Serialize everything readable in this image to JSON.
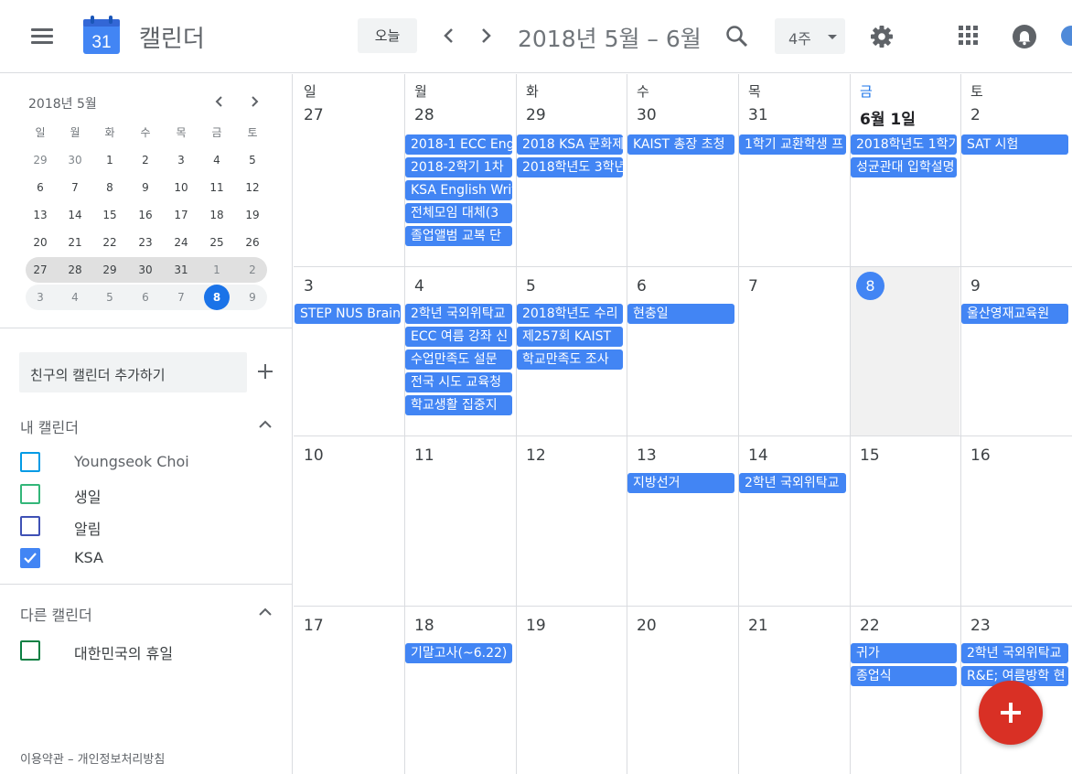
{
  "header": {
    "app_title": "캘린더",
    "logo_number": "31",
    "today_label": "오늘",
    "date_range": "2018년 5월 – 6월",
    "view_label": "4주"
  },
  "mini_calendar": {
    "title": "2018년 5월",
    "weekdays": [
      "일",
      "월",
      "화",
      "수",
      "목",
      "금",
      "토"
    ],
    "weeks": [
      [
        "29",
        "30",
        "1",
        "2",
        "3",
        "4",
        "5"
      ],
      [
        "6",
        "7",
        "8",
        "9",
        "10",
        "11",
        "12"
      ],
      [
        "13",
        "14",
        "15",
        "16",
        "17",
        "18",
        "19"
      ],
      [
        "20",
        "21",
        "22",
        "23",
        "24",
        "25",
        "26"
      ],
      [
        "27",
        "28",
        "29",
        "30",
        "31",
        "1",
        "2"
      ],
      [
        "3",
        "4",
        "5",
        "6",
        "7",
        "8",
        "9"
      ]
    ],
    "today": "8"
  },
  "sidebar": {
    "add_friend_placeholder": "친구의 캘린더 추가하기",
    "my_calendars_title": "내 캘린더",
    "my_calendars": [
      {
        "name": "Youngseok Choi",
        "color": "#039be5",
        "checked": false
      },
      {
        "name": "생일",
        "color": "#33b679",
        "checked": false
      },
      {
        "name": "알림",
        "color": "#3f51b5",
        "checked": false
      },
      {
        "name": "KSA",
        "color": "#4285f4",
        "checked": true
      }
    ],
    "other_calendars_title": "다른 캘린더",
    "other_calendars": [
      {
        "name": "대한민국의 휴일",
        "color": "#0b8043",
        "checked": false
      }
    ],
    "footer": "이용약관 – 개인정보처리방침"
  },
  "grid": {
    "day_names": [
      "일",
      "월",
      "화",
      "수",
      "목",
      "금",
      "토"
    ],
    "weeks": [
      {
        "days": [
          "27",
          "28",
          "29",
          "30",
          "31",
          "6월 1일",
          "2"
        ],
        "events": [
          [
            "2018-1 ECC English",
            "2018-2학기 1차",
            "KSA English Writing",
            "전체모임 대체(3",
            "졸업앨범 교복 단"
          ],
          [
            "2018 KSA 문화제",
            "2018학년도 3학년"
          ],
          [
            "KAIST 총장 초청"
          ],
          [
            "1학기 교환학생 프"
          ],
          [
            "2018학년도 1학기",
            "성균관대 입학설명"
          ],
          [
            "SAT 시험"
          ]
        ],
        "event_cols": [
          1,
          2,
          3,
          4,
          5,
          6
        ]
      },
      {
        "days": [
          "3",
          "4",
          "5",
          "6",
          "7",
          "8",
          "9"
        ],
        "events": [
          [
            "STEP NUS Brain"
          ],
          [
            "2학년 국외위탁교",
            "ECC 여름 강좌 신",
            "수업만족도 설문",
            "전국 시도 교육청",
            "학교생활 집중지"
          ],
          [
            "2018학년도 수리",
            "제257회 KAIST",
            "학교만족도 조사"
          ],
          [
            "현충일"
          ],
          [
            "울산영재교육원"
          ]
        ],
        "event_cols": [
          0,
          1,
          2,
          3,
          6
        ]
      },
      {
        "days": [
          "10",
          "11",
          "12",
          "13",
          "14",
          "15",
          "16"
        ],
        "events": [
          [
            "지방선거"
          ],
          [
            "2학년 국외위탁교"
          ]
        ],
        "event_cols": [
          3,
          4
        ]
      },
      {
        "days": [
          "17",
          "18",
          "19",
          "20",
          "21",
          "22",
          "23"
        ],
        "events": [
          [
            "기말고사(~6.22)"
          ],
          [
            "귀가",
            "종업식"
          ],
          [
            "2학년 국외위탁교",
            "R&E; 여름방학 현"
          ]
        ],
        "event_cols": [
          1,
          5,
          6
        ]
      }
    ]
  },
  "colors": {
    "event_blue": "#4285f4",
    "today_blue": "#1a73e8",
    "fab_red": "#d93025"
  }
}
